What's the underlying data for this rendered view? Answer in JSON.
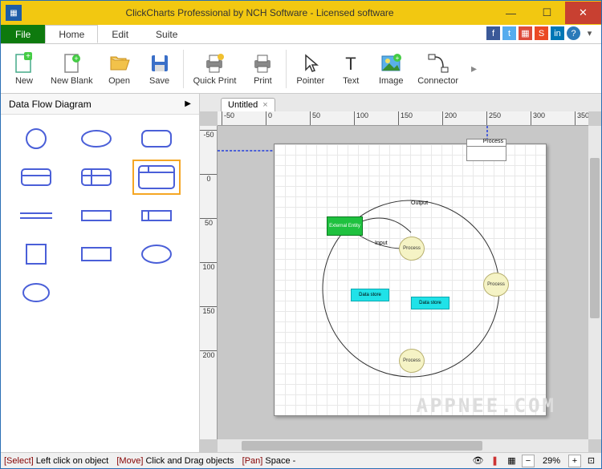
{
  "window": {
    "title": "ClickCharts Professional by NCH Software - Licensed software"
  },
  "menu": {
    "file": "File",
    "tabs": [
      {
        "label": "Home",
        "active": true
      },
      {
        "label": "Edit",
        "active": false
      },
      {
        "label": "Suite",
        "active": false
      }
    ]
  },
  "social_icons": [
    "facebook",
    "twitter",
    "google-plus",
    "stumbleupon",
    "linkedin",
    "help"
  ],
  "toolbar": [
    {
      "label": "New",
      "icon": "new"
    },
    {
      "label": "New Blank",
      "icon": "new-blank"
    },
    {
      "label": "Open",
      "icon": "open"
    },
    {
      "label": "Save",
      "icon": "save"
    },
    {
      "sep": true
    },
    {
      "label": "Quick Print",
      "icon": "quick-print"
    },
    {
      "label": "Print",
      "icon": "print"
    },
    {
      "sep": true
    },
    {
      "label": "Pointer",
      "icon": "pointer"
    },
    {
      "label": "Text",
      "icon": "text"
    },
    {
      "label": "Image",
      "icon": "image"
    },
    {
      "label": "Connector",
      "icon": "connector"
    }
  ],
  "sidebar": {
    "title": "Data Flow Diagram",
    "shapes": [
      "circle",
      "ellipse",
      "rounded-rect",
      "panel-h",
      "panel-grid",
      "panel-selected",
      "hline",
      "rect-flat",
      "rect-tab",
      "square",
      "rect",
      "ellipse2",
      "ellipse3"
    ],
    "selected_index": 5
  },
  "document": {
    "tab_label": "Untitled",
    "ruler_h": [
      "-50",
      "0",
      "50",
      "100",
      "150",
      "200",
      "250",
      "300",
      "350"
    ],
    "ruler_v": [
      "-50",
      "0",
      "50",
      "100",
      "150",
      "200"
    ]
  },
  "diagram": {
    "nodes": {
      "external_entity": "External Entity",
      "process1": "Process",
      "process2": "Process",
      "process3": "Process",
      "data_store1": "Data store",
      "data_store2": "Data store",
      "drag_process": "Process"
    },
    "edge_labels": {
      "output": "Output",
      "input": "Input"
    }
  },
  "status": {
    "select_label": "[Select]",
    "select_text": "Left click on object",
    "move_label": "[Move]",
    "move_text": "Click and Drag objects",
    "pan_label": "[Pan]",
    "pan_text": "Space -",
    "zoom": "29%"
  },
  "watermark": "APPNEE.COM"
}
